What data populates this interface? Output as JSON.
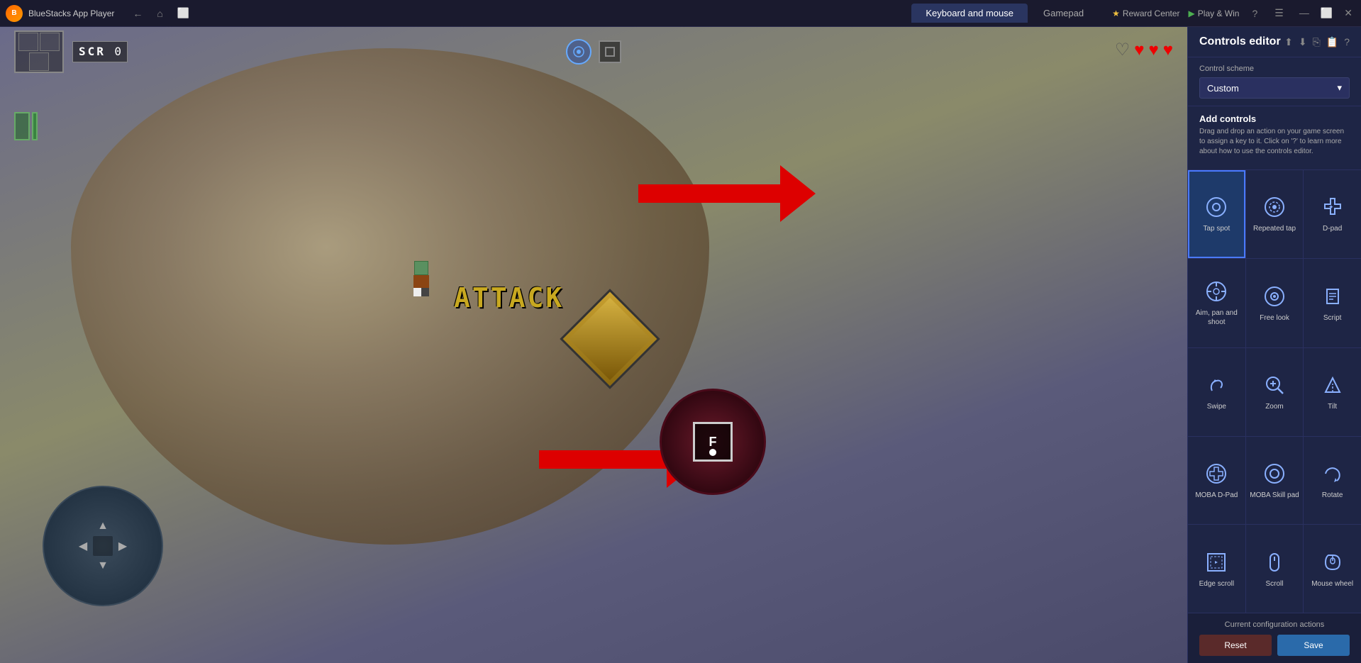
{
  "titlebar": {
    "app_name": "BlueStacks App Player",
    "tab_keyboard_mouse": "Keyboard and mouse",
    "tab_gamepad": "Gamepad",
    "reward_center": "Reward Center",
    "play_and_win": "Play & Win"
  },
  "hud": {
    "score": "SCR",
    "score_value": "0",
    "hearts": [
      "empty",
      "full",
      "full",
      "full"
    ]
  },
  "sidebar": {
    "title": "Controls editor",
    "control_scheme_label": "Control scheme",
    "control_scheme_value": "Custom",
    "add_controls_title": "Add controls",
    "add_controls_desc": "Drag and drop an action on your game screen to assign a key to it. Click on '?' to learn more about how to use the controls editor.",
    "controls": [
      {
        "id": "tap-spot",
        "label": "Tap spot",
        "icon": "○",
        "selected": true
      },
      {
        "id": "repeated-tap",
        "label": "Repeated tap",
        "icon": "◎"
      },
      {
        "id": "d-pad",
        "label": "D-pad",
        "icon": "✤"
      },
      {
        "id": "aim-pan-shoot",
        "label": "Aim, pan and shoot",
        "icon": "⊕"
      },
      {
        "id": "free-look",
        "label": "Free look",
        "icon": "◉"
      },
      {
        "id": "script",
        "label": "Script",
        "icon": "⬡"
      },
      {
        "id": "swipe",
        "label": "Swipe",
        "icon": "☞"
      },
      {
        "id": "zoom",
        "label": "Zoom",
        "icon": "⊕"
      },
      {
        "id": "tilt",
        "label": "Tilt",
        "icon": "⬡"
      },
      {
        "id": "moba-d-pad",
        "label": "MOBA D-Pad",
        "icon": "⊛"
      },
      {
        "id": "moba-skill-pad",
        "label": "MOBA Skill pad",
        "icon": "○"
      },
      {
        "id": "rotate",
        "label": "Rotate",
        "icon": "↺"
      },
      {
        "id": "edge-scroll",
        "label": "Edge scroll",
        "icon": "⬜"
      },
      {
        "id": "scroll",
        "label": "Scroll",
        "icon": "▭"
      },
      {
        "id": "mouse-wheel",
        "label": "Mouse wheel",
        "icon": "⊙"
      }
    ],
    "current_config_label": "Current configuration actions",
    "btn_reset": "Reset",
    "btn_save": "Save"
  },
  "game": {
    "attack_text": "ATTACK"
  }
}
